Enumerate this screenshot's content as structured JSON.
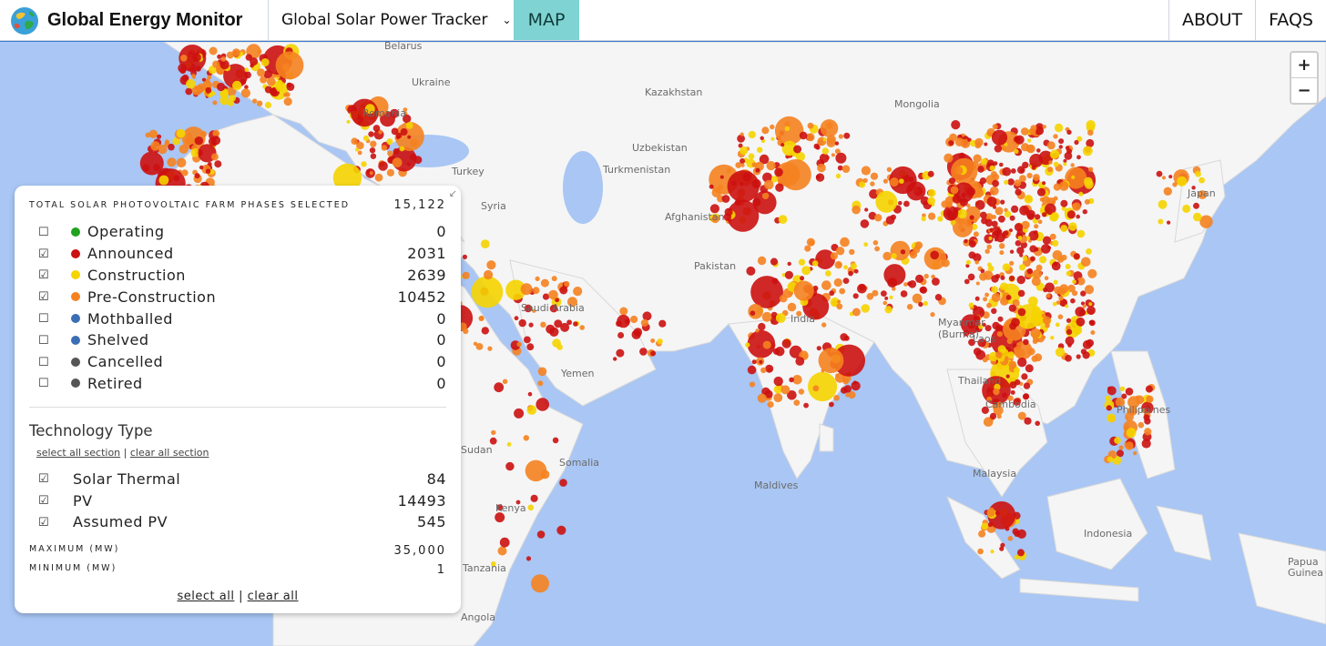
{
  "header": {
    "brand": "Global Energy Monitor",
    "tracker": "Global Solar Power Tracker",
    "map_tab": "MAP",
    "nav": [
      "ABOUT",
      "FAQS"
    ]
  },
  "map": {
    "labels": {
      "belarus": "Belarus",
      "ukraine": "Ukraine",
      "kazakhstan": "Kazakhstan",
      "mongolia": "Mongolia",
      "uzbekistan": "Uzbekistan",
      "turkmenistan": "Turkmenistan",
      "afghanistan": "Afghanistan",
      "pakistan": "Pakistan",
      "india": "India",
      "syria": "Syria",
      "saudi_arabia": "Saudi Arabia",
      "yemen": "Yemen",
      "somalia": "Somalia",
      "kenya": "Kenya",
      "maldives": "Maldives",
      "myanmar": "Myanmar\n(Burma)",
      "laos": "Laos",
      "thailand": "Thailand",
      "cambodia": "Cambodia",
      "philippines": "Philippines",
      "malaysia": "Malaysia",
      "indonesia": "Indonesia",
      "japan": "Japan",
      "papua": "Papua Guinea",
      "tanzania": "Tanzania",
      "angola": "Angola",
      "sudan": "Sudan",
      "turkey": "Turkey",
      "romania": "Romania"
    },
    "zoom_in": "+",
    "zoom_out": "−"
  },
  "panel": {
    "total_label": "TOTAL SOLAR PHOTOVOLTAIC FARM PHASES SELECTED",
    "total_value": "15,122",
    "statuses": [
      {
        "label": "Operating",
        "count": "0",
        "checked": false,
        "color": "#1fa31f"
      },
      {
        "label": "Announced",
        "count": "2031",
        "checked": true,
        "color": "#cc1111"
      },
      {
        "label": "Construction",
        "count": "2639",
        "checked": true,
        "color": "#f5d400"
      },
      {
        "label": "Pre-Construction",
        "count": "10452",
        "checked": true,
        "color": "#f58220"
      },
      {
        "label": "Mothballed",
        "count": "0",
        "checked": false,
        "color": "#3b6fb5"
      },
      {
        "label": "Shelved",
        "count": "0",
        "checked": false,
        "color": "#3b6fb5"
      },
      {
        "label": "Cancelled",
        "count": "0",
        "checked": false,
        "color": "#555555"
      },
      {
        "label": "Retired",
        "count": "0",
        "checked": false,
        "color": "#555555"
      }
    ],
    "tech_title": "Technology Type",
    "select_all_section": "select all section",
    "clear_all_section": "clear all section",
    "technologies": [
      {
        "label": "Solar Thermal",
        "count": "84",
        "checked": true
      },
      {
        "label": "PV",
        "count": "14493",
        "checked": true
      },
      {
        "label": "Assumed PV",
        "count": "545",
        "checked": true
      }
    ],
    "max_label": "MAXIMUM (MW)",
    "max_value": "35,000",
    "min_label": "MINIMUM (MW)",
    "min_value": "1",
    "select_all": "select all",
    "clear_all": "clear all",
    "divider": "|"
  }
}
